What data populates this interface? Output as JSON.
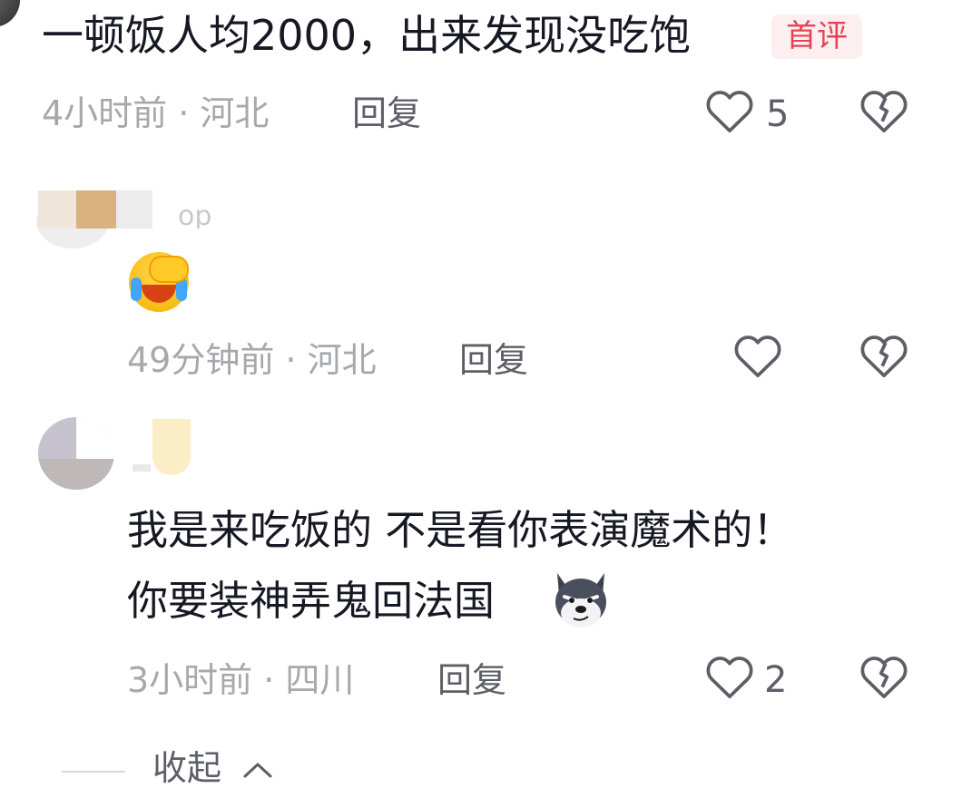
{
  "comments": [
    {
      "text": "一顿饭人均2000，出来发现没吃饱",
      "badge": "首评",
      "meta": "4小时前 · 河北",
      "reply_label": "回复",
      "like_count": "5"
    },
    {
      "meta": "49分钟前 · 河北",
      "reply_label": "回复",
      "emoji": "facepalm-crying-emoji"
    },
    {
      "line1": "我是来吃饭的 不是看你表演魔术的！",
      "line2": "你要装神弄鬼回法国",
      "emoji": "husky-dog-emoji",
      "meta": "3小时前 · 四川",
      "reply_label": "回复",
      "like_count": "2"
    }
  ],
  "collapse_label": "收起",
  "colors": {
    "text": "#161823",
    "meta": "#a7a8ac",
    "badge_bg": "#fdeef0",
    "badge_fg": "#e2455a"
  }
}
